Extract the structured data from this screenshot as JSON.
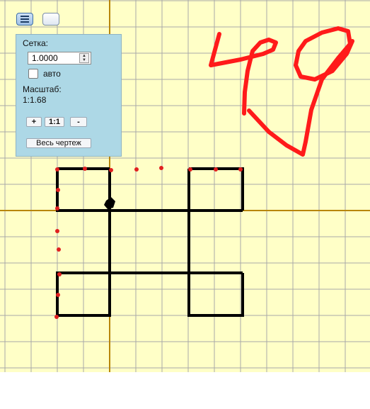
{
  "toolbar": {
    "menu_icon": "hamburger-menu-icon",
    "blank_icon": "blank-button-icon"
  },
  "panel": {
    "grid_label": "Сетка:",
    "grid_value": "1.0000",
    "auto_label": "авто",
    "auto_checked": false,
    "scale_label": "Масштаб:",
    "scale_value": "1:1.68",
    "zoom_in_label": "+",
    "zoom_reset_label": "1:1",
    "zoom_out_label": "-",
    "fit_all_label": "Весь чертеж"
  },
  "drawing": {
    "background_color": "#ffffc7",
    "grid_color": "#a9a9a9",
    "axis_color": "#b8860b",
    "line_color": "#000000",
    "point_color": "#e02020",
    "handwriting_text": "49",
    "handwriting_color": "#ff1a1a"
  }
}
